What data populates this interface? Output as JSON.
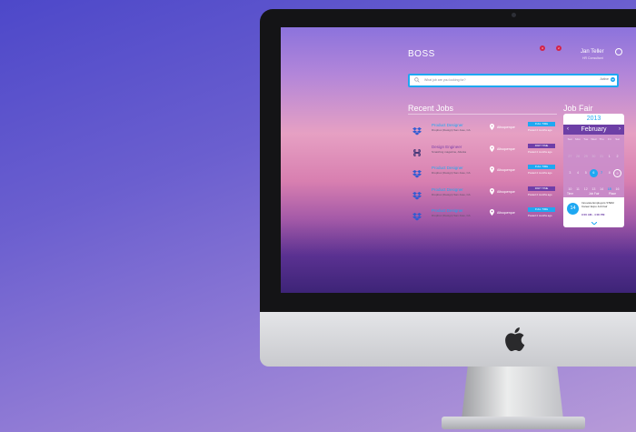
{
  "header": {
    "brand": "BOSS",
    "notifications": [
      "3",
      "2"
    ],
    "user": {
      "name": "Jan Teller",
      "role": "HR Consultant"
    }
  },
  "search": {
    "placeholder": "What job are you looking for?",
    "filter_label": "Active"
  },
  "recent_jobs": {
    "title": "Recent Jobs",
    "items": [
      {
        "title": "Product Designer",
        "company": "Dropbox (Design) San Jose, CA",
        "location": "Albuquerque",
        "badge": "FULL TIME",
        "posted": "Posted 2 months ago",
        "logo": "dropbox-icon",
        "badge_color": "#1ea8f2"
      },
      {
        "title": "Design Engineer",
        "company": "Smashing magazine, Atlanta",
        "location": "Albuquerque",
        "badge": "PART TIME",
        "posted": "Posted 2 months ago",
        "logo": "command-icon",
        "badge_color": "#6f3ea8"
      },
      {
        "title": "Product Designer",
        "company": "Dropbox (Design) San Jose, CA",
        "location": "Albuquerque",
        "badge": "FULL TIME",
        "posted": "Posted 2 months ago",
        "logo": "dropbox-icon",
        "badge_color": "#1ea8f2"
      },
      {
        "title": "Product Designer",
        "company": "Dropbox (Design) San Jose, CA",
        "location": "Albuquerque",
        "badge": "PART TIME",
        "posted": "Posted 2 months ago",
        "logo": "dropbox-icon",
        "badge_color": "#6f3ea8"
      },
      {
        "title": "Product Designer",
        "company": "Dropbox (Design) San Jose, CA",
        "location": "Albuquerque",
        "badge": "FULL TIME",
        "posted": "Posted 2 months ago",
        "logo": "dropbox-icon",
        "badge_color": "#1ea8f2"
      }
    ]
  },
  "job_fair": {
    "title": "Job Fair",
    "calendar": {
      "year": "2013",
      "month": "February",
      "prev": "‹",
      "next": "›",
      "weekdays": [
        "Sun",
        "Mon",
        "Tue",
        "Wed",
        "Thu",
        "Fri",
        "Sat"
      ],
      "days": [
        "27",
        "28",
        "29",
        "30",
        "31",
        "1",
        "2",
        "3",
        "4",
        "5",
        "6",
        "7",
        "8",
        "9",
        "10",
        "11",
        "12",
        "13",
        "14",
        "15",
        "16",
        "17",
        "18",
        "19",
        "20",
        "21",
        "22",
        "23",
        "24",
        "25",
        "26",
        "27",
        "28",
        "1",
        "2"
      ],
      "selected_day": "6",
      "event_days": [
        "7",
        "15",
        "28"
      ],
      "today": "9"
    },
    "tabs": [
      "Time",
      "Job Fair",
      "Place"
    ],
    "event": {
      "day": "14",
      "title": "Innovate Employers STEM Career Expo Job Fair",
      "time": "9:00 AM - 4:00 PM"
    }
  }
}
